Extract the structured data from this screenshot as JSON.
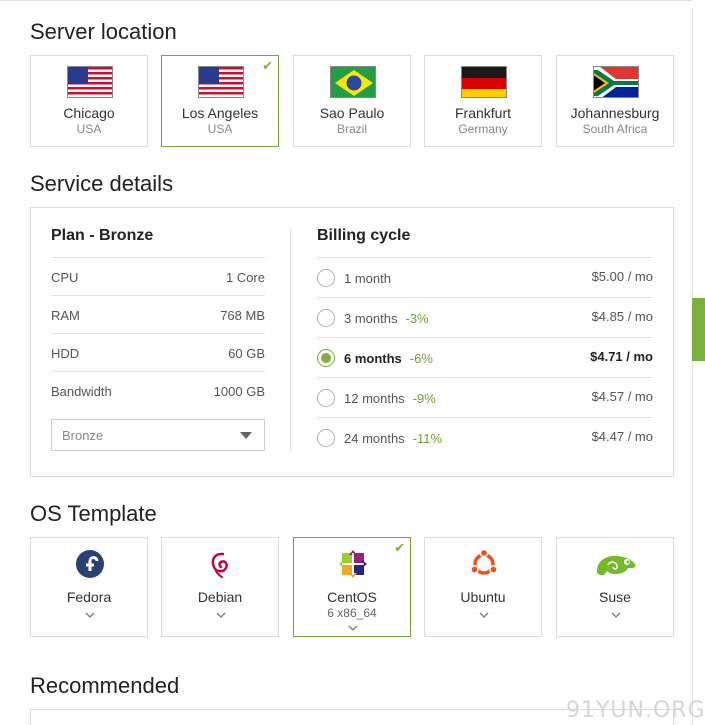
{
  "server_location": {
    "title": "Server location",
    "locations": [
      {
        "city": "Chicago",
        "country": "USA",
        "flag": "usa-flag",
        "selected": false
      },
      {
        "city": "Los Angeles",
        "country": "USA",
        "flag": "usa-flag",
        "selected": true
      },
      {
        "city": "Sao Paulo",
        "country": "Brazil",
        "flag": "brazil-flag",
        "selected": false
      },
      {
        "city": "Frankfurt",
        "country": "Germany",
        "flag": "germany-flag",
        "selected": false
      },
      {
        "city": "Johannesburg",
        "country": "South Africa",
        "flag": "south-africa-flag",
        "selected": false
      }
    ]
  },
  "service_details": {
    "title": "Service details",
    "plan_title": "Plan - Bronze",
    "specs": [
      {
        "label": "CPU",
        "value": "1 Core"
      },
      {
        "label": "RAM",
        "value": "768 MB"
      },
      {
        "label": "HDD",
        "value": "60 GB"
      },
      {
        "label": "Bandwidth",
        "value": "1000 GB"
      }
    ],
    "plan_select_value": "Bronze",
    "billing_title": "Billing cycle",
    "billing_options": [
      {
        "term": "1 month",
        "discount": "",
        "price": "$5.00 / mo",
        "selected": false
      },
      {
        "term": "3 months",
        "discount": "-3%",
        "price": "$4.85 / mo",
        "selected": false
      },
      {
        "term": "6 months",
        "discount": "-6%",
        "price": "$4.71 / mo",
        "selected": true
      },
      {
        "term": "12 months",
        "discount": "-9%",
        "price": "$4.57 / mo",
        "selected": false
      },
      {
        "term": "24 months",
        "discount": "-11%",
        "price": "$4.47 / mo",
        "selected": false
      }
    ]
  },
  "os_template": {
    "title": "OS Template",
    "options": [
      {
        "name": "Fedora",
        "version": "",
        "icon": "fedora-icon",
        "selected": false
      },
      {
        "name": "Debian",
        "version": "",
        "icon": "debian-icon",
        "selected": false
      },
      {
        "name": "CentOS",
        "version": "6 x86_64",
        "icon": "centos-icon",
        "selected": true
      },
      {
        "name": "Ubuntu",
        "version": "",
        "icon": "ubuntu-icon",
        "selected": false
      },
      {
        "name": "Suse",
        "version": "",
        "icon": "suse-icon",
        "selected": false
      }
    ]
  },
  "recommended": {
    "title": "Recommended"
  },
  "watermark": "91YUN.ORG",
  "colors": {
    "accent": "#7ab03b",
    "discount": "#6ea236",
    "border": "#dcdcdc"
  }
}
